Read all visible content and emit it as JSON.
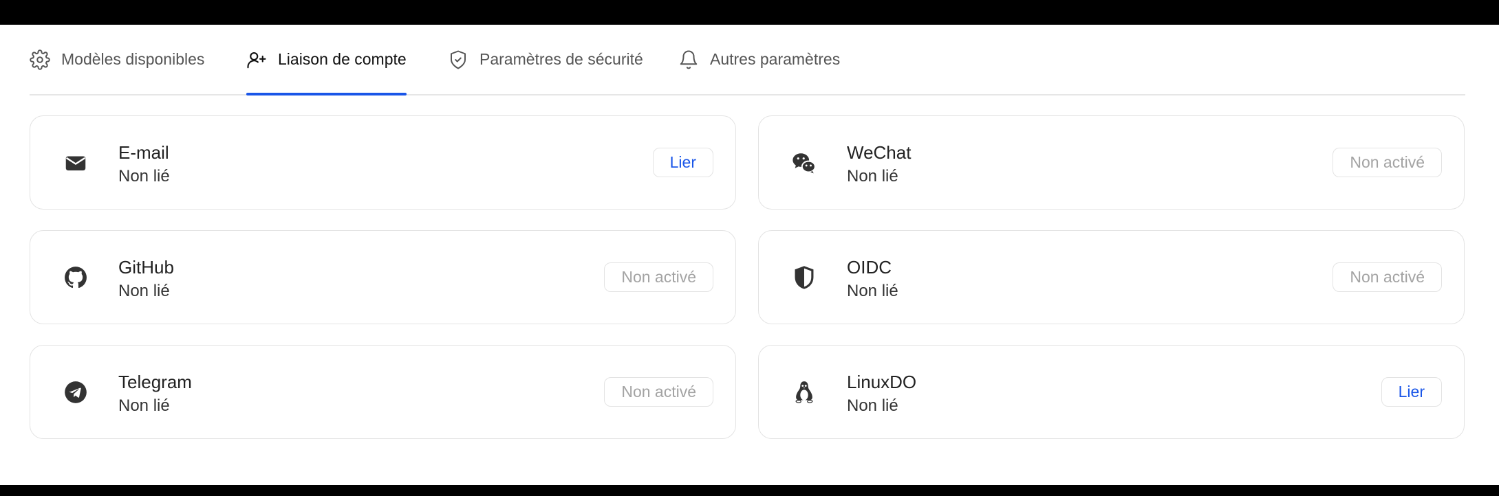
{
  "tabs": [
    {
      "label": "Modèles disponibles",
      "icon": "gear-icon"
    },
    {
      "label": "Liaison de compte",
      "icon": "user-plus-icon",
      "active": true
    },
    {
      "label": "Paramètres de sécurité",
      "icon": "shield-check-icon"
    },
    {
      "label": "Autres paramètres",
      "icon": "bell-icon"
    }
  ],
  "accounts": [
    {
      "name": "E-mail",
      "status": "Non lié",
      "action": "Lier",
      "action_state": "link",
      "icon": "mail-icon"
    },
    {
      "name": "WeChat",
      "status": "Non lié",
      "action": "Non activé",
      "action_state": "disabled",
      "icon": "wechat-icon"
    },
    {
      "name": "GitHub",
      "status": "Non lié",
      "action": "Non activé",
      "action_state": "disabled",
      "icon": "github-icon"
    },
    {
      "name": "OIDC",
      "status": "Non lié",
      "action": "Non activé",
      "action_state": "disabled",
      "icon": "shield-icon"
    },
    {
      "name": "Telegram",
      "status": "Non lié",
      "action": "Non activé",
      "action_state": "disabled",
      "icon": "telegram-icon"
    },
    {
      "name": "LinuxDO",
      "status": "Non lié",
      "action": "Lier",
      "action_state": "link",
      "icon": "linux-penguin-icon"
    }
  ],
  "colors": {
    "accent": "#1a56e8",
    "border": "#e3e3e3",
    "muted": "#a3a3a3"
  }
}
